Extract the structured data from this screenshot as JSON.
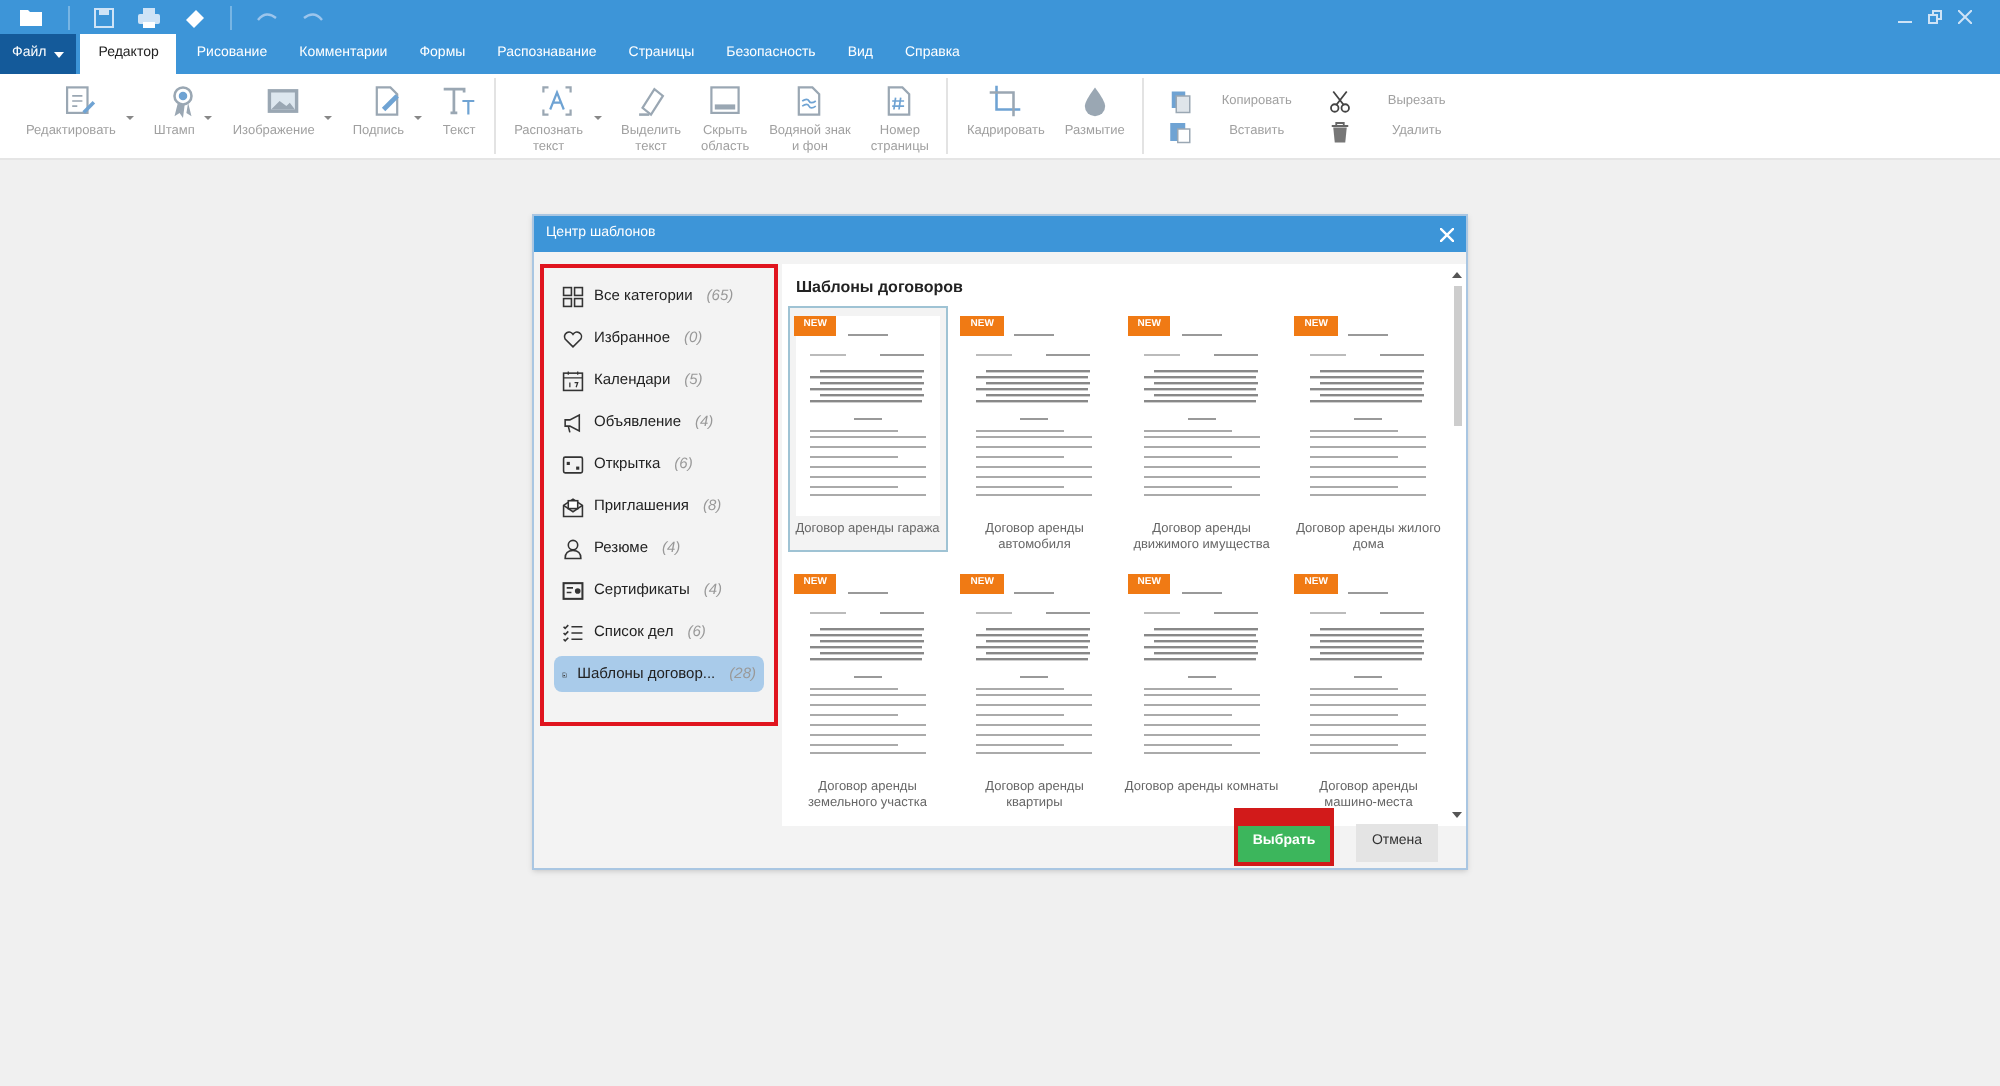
{
  "menu_tabs": [
    {
      "label": "Файл",
      "kind": "file",
      "selected": false
    },
    {
      "label": "Редактор",
      "kind": "tab",
      "selected": true
    },
    {
      "label": "Рисование",
      "kind": "tab",
      "selected": false
    },
    {
      "label": "Комментарии",
      "kind": "tab",
      "selected": false
    },
    {
      "label": "Формы",
      "kind": "tab",
      "selected": false
    },
    {
      "label": "Распознавание",
      "kind": "tab",
      "selected": false
    },
    {
      "label": "Страницы",
      "kind": "tab",
      "selected": false
    },
    {
      "label": "Безопасность",
      "kind": "tab",
      "selected": false
    },
    {
      "label": "Вид",
      "kind": "tab",
      "selected": false
    },
    {
      "label": "Справка",
      "kind": "tab",
      "selected": false
    }
  ],
  "ribbon": [
    {
      "kind": "large",
      "label": "Редактировать",
      "dropdown": true
    },
    {
      "kind": "large",
      "label": "Штамп",
      "dropdown": true
    },
    {
      "kind": "large",
      "label": "Изображение",
      "dropdown": true
    },
    {
      "kind": "large",
      "label": "Подпись",
      "dropdown": true
    },
    {
      "kind": "large",
      "label": "Текст",
      "dropdown": false
    },
    {
      "kind": "separator"
    },
    {
      "kind": "large",
      "label": "Распознать\nтекст",
      "dropdown": true
    },
    {
      "kind": "large",
      "label": "Выделить\nтекст",
      "dropdown": false
    },
    {
      "kind": "large",
      "label": "Скрыть\nобласть",
      "dropdown": false
    },
    {
      "kind": "large",
      "label": "Водяной знак\nи фон",
      "dropdown": false
    },
    {
      "kind": "large",
      "label": "Номер\nстраницы",
      "dropdown": false
    },
    {
      "kind": "separator"
    },
    {
      "kind": "large",
      "label": "Кадрировать",
      "dropdown": false
    },
    {
      "kind": "large",
      "label": "Размытие",
      "dropdown": false
    },
    {
      "kind": "separator"
    },
    {
      "kind": "small",
      "items": [
        {
          "label": "Копировать"
        },
        {
          "label": "Вставить"
        }
      ]
    },
    {
      "kind": "small",
      "items": [
        {
          "label": "Вырезать"
        },
        {
          "label": "Удалить"
        }
      ]
    }
  ],
  "dialog": {
    "title": "Центр шаблонов",
    "categories_highlighted": true,
    "categories": [
      {
        "label": "Все категории",
        "count": "(65)",
        "selected": false
      },
      {
        "label": "Избранное",
        "count": "(0)",
        "selected": false
      },
      {
        "label": "Календари",
        "count": "(5)",
        "selected": false
      },
      {
        "label": "Объявление",
        "count": "(4)",
        "selected": false
      },
      {
        "label": "Открытка",
        "count": "(6)",
        "selected": false
      },
      {
        "label": "Приглашения",
        "count": "(8)",
        "selected": false
      },
      {
        "label": "Резюме",
        "count": "(4)",
        "selected": false
      },
      {
        "label": "Сертификаты",
        "count": "(4)",
        "selected": false
      },
      {
        "label": "Список дел",
        "count": "(6)",
        "selected": false
      },
      {
        "label": "Шаблоны договор...",
        "count": "(28)",
        "selected": true
      }
    ],
    "section_title": "Шаблоны договоров",
    "templates": [
      {
        "title": "Договор аренды гаража",
        "badge": "NEW",
        "selected": true
      },
      {
        "title": "Договор аренды автомобиля",
        "badge": "NEW",
        "selected": false
      },
      {
        "title": "Договор аренды движимого имущества",
        "badge": "NEW",
        "selected": false
      },
      {
        "title": "Договор аренды жилого дома",
        "badge": "NEW",
        "selected": false
      },
      {
        "title": "Договор аренды земельного участка",
        "badge": "NEW",
        "selected": false
      },
      {
        "title": "Договор аренды квартиры",
        "badge": "NEW",
        "selected": false
      },
      {
        "title": "Договор аренды комнаты",
        "badge": "NEW",
        "selected": false
      },
      {
        "title": "Договор аренды машино-места",
        "badge": "NEW",
        "selected": false
      }
    ],
    "buttons": [
      {
        "label": "Выбрать",
        "kind": "primary",
        "highlighted": true
      },
      {
        "label": "Отмена",
        "kind": "secondary",
        "highlighted": false
      }
    ]
  }
}
